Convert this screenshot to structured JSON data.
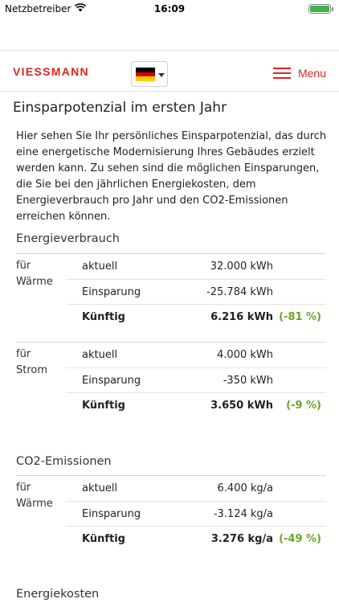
{
  "status_bar": {
    "carrier": "Netzbetreiber",
    "time": "16:09"
  },
  "header": {
    "logo_text": "VIESSMANN",
    "menu_label": "Menu",
    "flag_colors": [
      "#000000",
      "#dd0000",
      "#ffce00"
    ]
  },
  "page": {
    "title": "Einsparpotenzial im ersten Jahr",
    "intro": "Hier sehen Sie Ihr persönliches Einsparpotenzial, das durch eine energetische Modernisierung Ihres Gebäudes erzielt werden kann. Zu sehen sind die möglichen Einsparungen, die Sie bei den jährlichen Energiekosten, dem Energieverbrauch pro Jahr und den CO2-Emissionen erreichen können."
  },
  "sections": [
    {
      "title": "Energieverbrauch",
      "groups": [
        {
          "category_line1": "für",
          "category_line2": "Wärme",
          "rows": [
            {
              "label": "aktuell",
              "value": "32.000 kWh"
            },
            {
              "label": "Einsparung",
              "value": "-25.784 kWh"
            },
            {
              "label": "Künftig",
              "value": "6.216 kWh",
              "percent": "(-81 %)"
            }
          ]
        },
        {
          "category_line1": "für",
          "category_line2": "Strom",
          "rows": [
            {
              "label": "aktuell",
              "value": "4.000 kWh"
            },
            {
              "label": "Einsparung",
              "value": "-350 kWh"
            },
            {
              "label": "Künftig",
              "value": "3.650 kWh",
              "percent": "(-9 %)"
            }
          ]
        }
      ]
    },
    {
      "title": "CO2-Emissionen",
      "groups": [
        {
          "category_line1": "für",
          "category_line2": "Wärme",
          "rows": [
            {
              "label": "aktuell",
              "value": "6.400 kg/a"
            },
            {
              "label": "Einsparung",
              "value": "-3.124 kg/a"
            },
            {
              "label": "Künftig",
              "value": "3.276 kg/a",
              "percent": "(-49 %)"
            }
          ]
        }
      ]
    },
    {
      "title": "Energiekosten"
    }
  ]
}
